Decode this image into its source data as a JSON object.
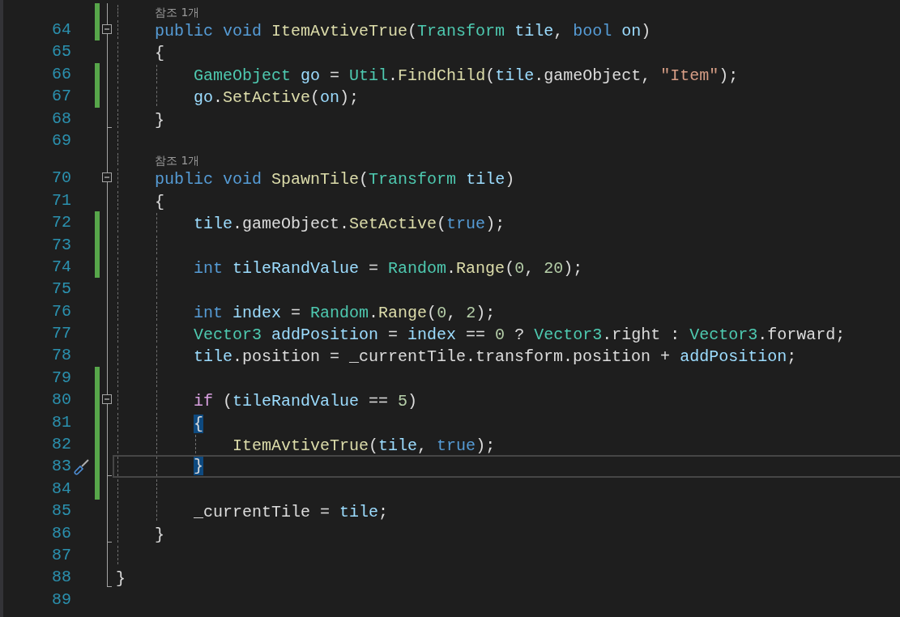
{
  "editor": {
    "rows": [
      {
        "kind": "codelens",
        "text": "참조 1개",
        "changed": true,
        "in_fold": true,
        "fold_start": false,
        "fold_end": false
      },
      {
        "kind": "code",
        "number": "64",
        "changed": true,
        "in_fold": true,
        "fold_start": true,
        "fold_end": false,
        "tokens": [
          {
            "text": "    public ",
            "kind": "keyword"
          },
          {
            "text": "void ",
            "kind": "keyword"
          },
          {
            "text": "ItemAvtiveTrue",
            "kind": "method"
          },
          {
            "text": "(",
            "kind": "plain"
          },
          {
            "text": "Transform ",
            "kind": "type"
          },
          {
            "text": "tile",
            "kind": "variable"
          },
          {
            "text": ", ",
            "kind": "plain"
          },
          {
            "text": "bool ",
            "kind": "keyword"
          },
          {
            "text": "on",
            "kind": "variable"
          },
          {
            "text": ")",
            "kind": "plain"
          }
        ]
      },
      {
        "kind": "code",
        "number": "65",
        "changed": false,
        "in_fold": true,
        "fold_start": false,
        "fold_end": false,
        "tokens": [
          {
            "text": "    {",
            "kind": "plain"
          }
        ]
      },
      {
        "kind": "code",
        "number": "66",
        "changed": true,
        "in_fold": true,
        "fold_start": false,
        "fold_end": false,
        "tokens": [
          {
            "text": "        GameObject ",
            "kind": "type"
          },
          {
            "text": "go",
            "kind": "variable"
          },
          {
            "text": " = ",
            "kind": "plain"
          },
          {
            "text": "Util",
            "kind": "type"
          },
          {
            "text": ".",
            "kind": "plain"
          },
          {
            "text": "FindChild",
            "kind": "method"
          },
          {
            "text": "(",
            "kind": "plain"
          },
          {
            "text": "tile",
            "kind": "variable"
          },
          {
            "text": ".gameObject, ",
            "kind": "plain"
          },
          {
            "text": "\"Item\"",
            "kind": "string"
          },
          {
            "text": ");",
            "kind": "plain"
          }
        ]
      },
      {
        "kind": "code",
        "number": "67",
        "changed": true,
        "in_fold": true,
        "fold_start": false,
        "fold_end": false,
        "tokens": [
          {
            "text": "        go",
            "kind": "variable"
          },
          {
            "text": ".",
            "kind": "plain"
          },
          {
            "text": "SetActive",
            "kind": "method"
          },
          {
            "text": "(",
            "kind": "plain"
          },
          {
            "text": "on",
            "kind": "variable"
          },
          {
            "text": ");",
            "kind": "plain"
          }
        ]
      },
      {
        "kind": "code",
        "number": "68",
        "changed": false,
        "in_fold": true,
        "fold_start": false,
        "fold_end": true,
        "tokens": [
          {
            "text": "    }",
            "kind": "plain"
          }
        ]
      },
      {
        "kind": "code",
        "number": "69",
        "changed": false,
        "in_fold": true,
        "fold_start": false,
        "fold_end": false,
        "tokens": []
      },
      {
        "kind": "codelens",
        "text": "참조 1개",
        "changed": false,
        "in_fold": true,
        "fold_start": false,
        "fold_end": false
      },
      {
        "kind": "code",
        "number": "70",
        "changed": false,
        "in_fold": true,
        "fold_start": true,
        "fold_end": false,
        "tokens": [
          {
            "text": "    public ",
            "kind": "keyword"
          },
          {
            "text": "void ",
            "kind": "keyword"
          },
          {
            "text": "SpawnTile",
            "kind": "method"
          },
          {
            "text": "(",
            "kind": "plain"
          },
          {
            "text": "Transform ",
            "kind": "type"
          },
          {
            "text": "tile",
            "kind": "variable"
          },
          {
            "text": ")",
            "kind": "plain"
          }
        ]
      },
      {
        "kind": "code",
        "number": "71",
        "changed": false,
        "in_fold": true,
        "fold_start": false,
        "fold_end": false,
        "tokens": [
          {
            "text": "    {",
            "kind": "plain"
          }
        ]
      },
      {
        "kind": "code",
        "number": "72",
        "changed": true,
        "in_fold": true,
        "fold_start": false,
        "fold_end": false,
        "tokens": [
          {
            "text": "        tile",
            "kind": "variable"
          },
          {
            "text": ".gameObject.",
            "kind": "plain"
          },
          {
            "text": "SetActive",
            "kind": "method"
          },
          {
            "text": "(",
            "kind": "plain"
          },
          {
            "text": "true",
            "kind": "keyword"
          },
          {
            "text": ");",
            "kind": "plain"
          }
        ]
      },
      {
        "kind": "code",
        "number": "73",
        "changed": true,
        "in_fold": true,
        "fold_start": false,
        "fold_end": false,
        "tokens": []
      },
      {
        "kind": "code",
        "number": "74",
        "changed": true,
        "in_fold": true,
        "fold_start": false,
        "fold_end": false,
        "tokens": [
          {
            "text": "        int ",
            "kind": "keyword"
          },
          {
            "text": "tileRandValue",
            "kind": "variable"
          },
          {
            "text": " = ",
            "kind": "plain"
          },
          {
            "text": "Random",
            "kind": "type"
          },
          {
            "text": ".",
            "kind": "plain"
          },
          {
            "text": "Range",
            "kind": "method"
          },
          {
            "text": "(",
            "kind": "plain"
          },
          {
            "text": "0",
            "kind": "number"
          },
          {
            "text": ", ",
            "kind": "plain"
          },
          {
            "text": "20",
            "kind": "number"
          },
          {
            "text": ");",
            "kind": "plain"
          }
        ]
      },
      {
        "kind": "code",
        "number": "75",
        "changed": false,
        "in_fold": true,
        "fold_start": false,
        "fold_end": false,
        "tokens": []
      },
      {
        "kind": "code",
        "number": "76",
        "changed": false,
        "in_fold": true,
        "fold_start": false,
        "fold_end": false,
        "tokens": [
          {
            "text": "        int ",
            "kind": "keyword"
          },
          {
            "text": "index",
            "kind": "variable"
          },
          {
            "text": " = ",
            "kind": "plain"
          },
          {
            "text": "Random",
            "kind": "type"
          },
          {
            "text": ".",
            "kind": "plain"
          },
          {
            "text": "Range",
            "kind": "method"
          },
          {
            "text": "(",
            "kind": "plain"
          },
          {
            "text": "0",
            "kind": "number"
          },
          {
            "text": ", ",
            "kind": "plain"
          },
          {
            "text": "2",
            "kind": "number"
          },
          {
            "text": ");",
            "kind": "plain"
          }
        ]
      },
      {
        "kind": "code",
        "number": "77",
        "changed": false,
        "in_fold": true,
        "fold_start": false,
        "fold_end": false,
        "tokens": [
          {
            "text": "        Vector3 ",
            "kind": "type"
          },
          {
            "text": "addPosition",
            "kind": "variable"
          },
          {
            "text": " = ",
            "kind": "plain"
          },
          {
            "text": "index",
            "kind": "variable"
          },
          {
            "text": " == ",
            "kind": "plain"
          },
          {
            "text": "0",
            "kind": "number"
          },
          {
            "text": " ? ",
            "kind": "plain"
          },
          {
            "text": "Vector3",
            "kind": "type"
          },
          {
            "text": ".right : ",
            "kind": "plain"
          },
          {
            "text": "Vector3",
            "kind": "type"
          },
          {
            "text": ".forward;",
            "kind": "plain"
          }
        ]
      },
      {
        "kind": "code",
        "number": "78",
        "changed": false,
        "in_fold": true,
        "fold_start": false,
        "fold_end": false,
        "tokens": [
          {
            "text": "        tile",
            "kind": "variable"
          },
          {
            "text": ".position = _currentTile.transform.position + ",
            "kind": "plain"
          },
          {
            "text": "addPosition",
            "kind": "variable"
          },
          {
            "text": ";",
            "kind": "plain"
          }
        ]
      },
      {
        "kind": "code",
        "number": "79",
        "changed": true,
        "in_fold": true,
        "fold_start": false,
        "fold_end": false,
        "tokens": []
      },
      {
        "kind": "code",
        "number": "80",
        "changed": true,
        "in_fold": true,
        "fold_start": true,
        "fold_end": false,
        "tokens": [
          {
            "text": "        if",
            "kind": "control"
          },
          {
            "text": " (",
            "kind": "plain"
          },
          {
            "text": "tileRandValue",
            "kind": "variable"
          },
          {
            "text": " == ",
            "kind": "plain"
          },
          {
            "text": "5",
            "kind": "number"
          },
          {
            "text": ")",
            "kind": "plain"
          }
        ]
      },
      {
        "kind": "code",
        "number": "81",
        "changed": true,
        "in_fold": true,
        "fold_start": false,
        "fold_end": false,
        "tokens": [
          {
            "text": "        {",
            "kind": "brace-match"
          }
        ]
      },
      {
        "kind": "code",
        "number": "82",
        "changed": true,
        "in_fold": true,
        "fold_start": false,
        "fold_end": false,
        "tokens": [
          {
            "text": "            ItemAvtiveTrue",
            "kind": "method"
          },
          {
            "text": "(",
            "kind": "plain"
          },
          {
            "text": "tile",
            "kind": "variable"
          },
          {
            "text": ", ",
            "kind": "plain"
          },
          {
            "text": "true",
            "kind": "keyword"
          },
          {
            "text": ");",
            "kind": "plain"
          }
        ]
      },
      {
        "kind": "code",
        "number": "83",
        "changed": true,
        "in_fold": true,
        "fold_start": false,
        "fold_end": true,
        "current": true,
        "quick_action": true,
        "tokens": [
          {
            "text": "        }",
            "kind": "brace-match"
          }
        ]
      },
      {
        "kind": "code",
        "number": "84",
        "changed": true,
        "in_fold": true,
        "fold_start": false,
        "fold_end": false,
        "tokens": []
      },
      {
        "kind": "code",
        "number": "85",
        "changed": false,
        "in_fold": true,
        "fold_start": false,
        "fold_end": false,
        "tokens": [
          {
            "text": "        _currentTile = ",
            "kind": "plain"
          },
          {
            "text": "tile",
            "kind": "variable"
          },
          {
            "text": ";",
            "kind": "plain"
          }
        ]
      },
      {
        "kind": "code",
        "number": "86",
        "changed": false,
        "in_fold": true,
        "fold_start": false,
        "fold_end": true,
        "tokens": [
          {
            "text": "    }",
            "kind": "plain"
          }
        ]
      },
      {
        "kind": "code",
        "number": "87",
        "changed": false,
        "in_fold": true,
        "fold_start": false,
        "fold_end": false,
        "tokens": []
      },
      {
        "kind": "code",
        "number": "88",
        "changed": false,
        "in_fold": true,
        "fold_start": false,
        "fold_end": true,
        "tokens": [
          {
            "text": "}",
            "kind": "plain"
          }
        ]
      },
      {
        "kind": "code",
        "number": "89",
        "changed": false,
        "in_fold": false,
        "tokens": []
      }
    ]
  }
}
